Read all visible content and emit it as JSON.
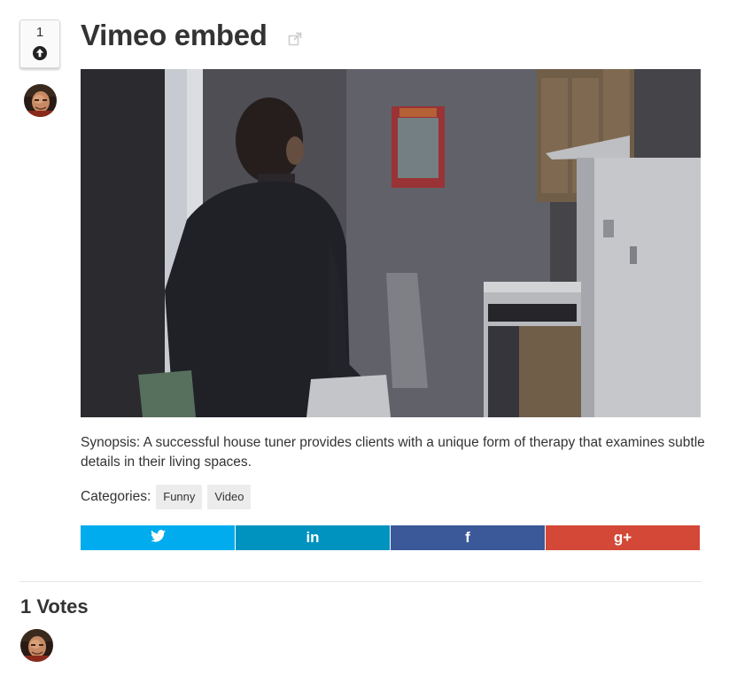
{
  "vote": {
    "count": "1",
    "upvote_icon": "arrow-up-circle-icon"
  },
  "post": {
    "title": "Vimeo embed",
    "external_link_icon": "external-link-icon",
    "synopsis": "Synopsis: A successful house tuner provides clients with a unique form of therapy that examines subtle details in their living spaces.",
    "categories_label": "Categories:",
    "categories": [
      "Funny",
      "Video"
    ]
  },
  "share": {
    "buttons": [
      {
        "network": "twitter",
        "icon": "twitter-icon",
        "color": "#00aced"
      },
      {
        "network": "linkedin",
        "icon": "linkedin-icon",
        "color": "#0093bf",
        "glyph": "in"
      },
      {
        "network": "facebook",
        "icon": "facebook-icon",
        "color": "#3b5998",
        "glyph": "f"
      },
      {
        "network": "google-plus",
        "icon": "google-plus-icon",
        "color": "#d34836",
        "glyph": "g+"
      }
    ]
  },
  "votes": {
    "heading": "1 Votes"
  }
}
